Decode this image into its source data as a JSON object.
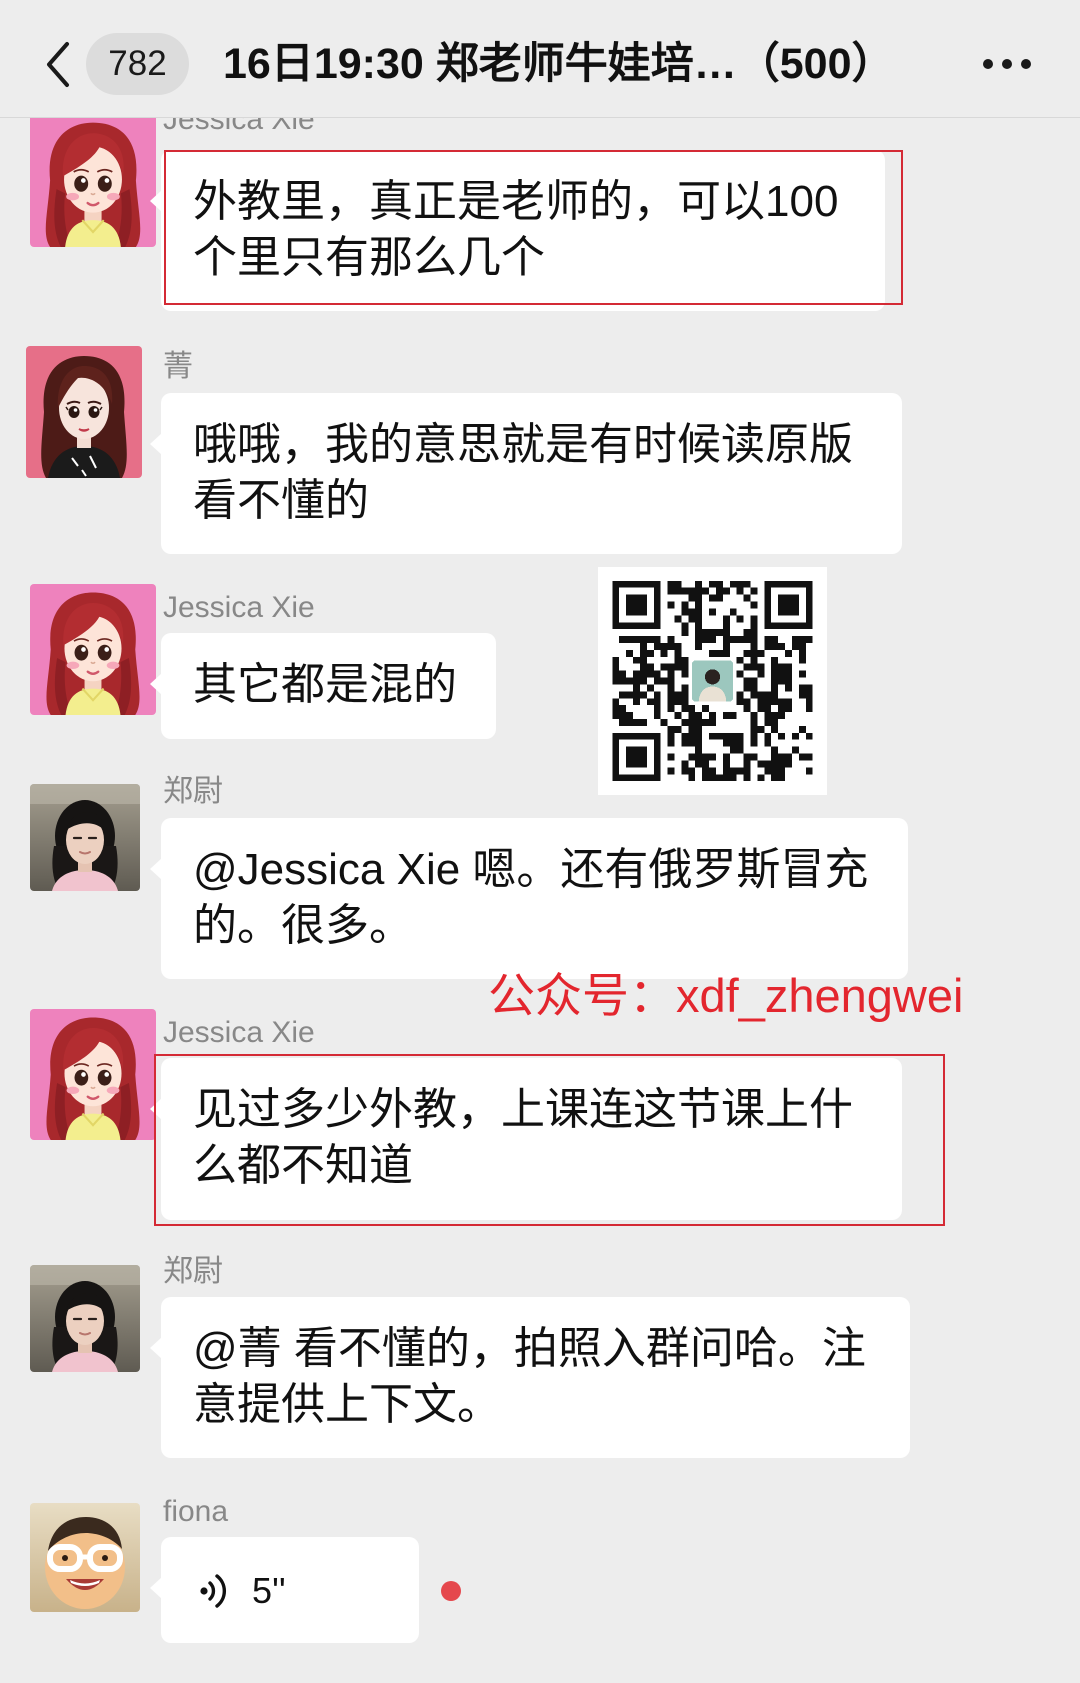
{
  "theme": {
    "background": "#EDEDED",
    "bubble": "#FFFFFF",
    "highlight_box": "#D42A35",
    "watermark_text": "#E3262E",
    "unread_dot": "#E5484D",
    "sender_name": "#888888"
  },
  "header": {
    "back_icon": "chevron-left-icon",
    "unread_count": "782",
    "title": "16日19:30 郑老师牛娃培…（500）",
    "more_icon": "more-dots-icon"
  },
  "messages": [
    {
      "sender": "Jessica Xie",
      "lines": [
        "外教里，真正是老师的，可以100",
        "个里只有那么几个"
      ],
      "highlighted": true
    },
    {
      "sender": "菁",
      "lines": [
        "哦哦，我的意思就是有时候读原版",
        "看不懂的"
      ],
      "highlighted": false
    },
    {
      "sender": "Jessica Xie",
      "lines": [
        "其它都是混的"
      ],
      "highlighted": false
    },
    {
      "sender": "郑尉",
      "lines": [
        "@Jessica Xie 嗯。还有俄罗斯冒充",
        "的。很多。"
      ],
      "highlighted": false
    },
    {
      "sender": "Jessica Xie",
      "lines": [
        "见过多少外教，上课连这节课上什",
        "么都不知道"
      ],
      "highlighted": true
    },
    {
      "sender": "郑尉",
      "lines": [
        "@菁 看不懂的，拍照入群问哈。注",
        "意提供上下文。"
      ],
      "highlighted": false
    },
    {
      "sender": "fiona",
      "voice_icon": "voice-wave-icon",
      "voice_duration": "5''",
      "unread": true
    }
  ],
  "watermark": {
    "text": "公众号：xdf_zhengwei"
  }
}
